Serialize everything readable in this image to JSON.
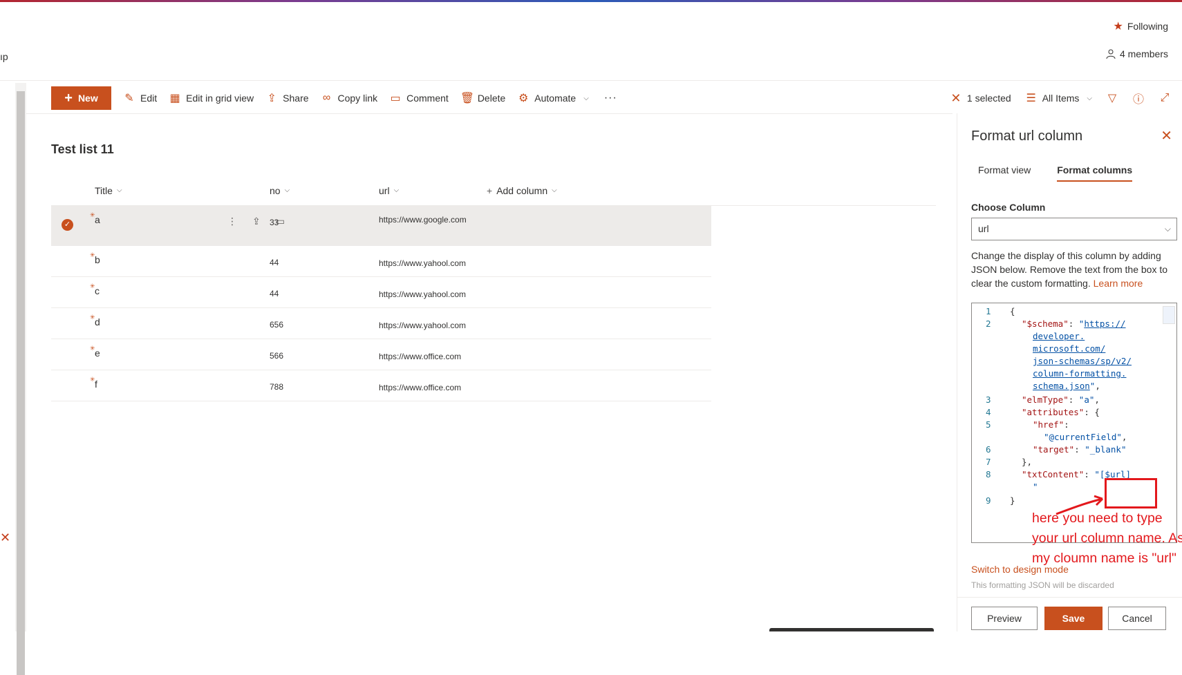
{
  "header": {
    "following_label": "Following",
    "members_label": "4 members",
    "cut_text": "ıp"
  },
  "commandbar": {
    "new_label": "New",
    "edit_label": "Edit",
    "grid_label": "Edit in grid view",
    "share_label": "Share",
    "copylink_label": "Copy link",
    "comment_label": "Comment",
    "delete_label": "Delete",
    "automate_label": "Automate",
    "more_label": "···",
    "selected_label": "1 selected",
    "view_label": "All Items"
  },
  "list": {
    "title": "Test list 11",
    "columns": {
      "title": "Title",
      "no": "no",
      "url": "url",
      "add": "Add column"
    },
    "rows": [
      {
        "title": "a",
        "no": "33",
        "url": "https://www.google.com"
      },
      {
        "title": "b",
        "no": "44",
        "url": "https://www.yahool.com"
      },
      {
        "title": "c",
        "no": "44",
        "url": "https://www.yahool.com"
      },
      {
        "title": "d",
        "no": "656",
        "url": "https://www.yahool.com"
      },
      {
        "title": "e",
        "no": "566",
        "url": "https://www.office.com"
      },
      {
        "title": "f",
        "no": "788",
        "url": "https://www.office.com"
      }
    ]
  },
  "panel": {
    "title": "Format url column",
    "tab_view": "Format view",
    "tab_columns": "Format columns",
    "choose_label": "Choose Column",
    "choose_value": "url",
    "description": "Change the display of this column by adding JSON below. Remove the text from the box to clear the custom formatting.",
    "learn_more": "Learn more",
    "switch_label": "Switch to design mode",
    "discard_label": "This formatting JSON will be discarded",
    "preview_label": "Preview",
    "save_label": "Save",
    "cancel_label": "Cancel",
    "annotation": "here you need to type your url column name. As my cloumn name is \"url\""
  },
  "colors": {
    "accent": "#c8501e",
    "annotation_red": "#e3181c"
  }
}
